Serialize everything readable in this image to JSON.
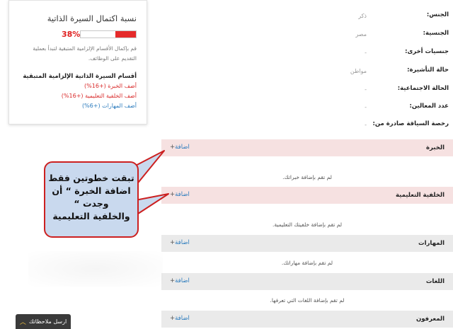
{
  "completion_card": {
    "title": "نسبة اكتمال السيرة الذاتية",
    "percent_text": "38%",
    "progress_value": 0.38,
    "note": "قم بإكمال الأقسام الإلزامية المتبقية لتبدأ بعملية التقديم على الوظائف.",
    "remaining_title": "أقسام السيرة الذاتية الإلزامية المتبقية",
    "links": [
      {
        "label": "أضف الخبرة (+16%)",
        "color": "red"
      },
      {
        "label": "أضف الخلفية التعليمية (+16%)",
        "color": "red"
      },
      {
        "label": "أضف المهارات (+6%)",
        "color": "blue"
      }
    ]
  },
  "profile_info": [
    {
      "label": "الجنس:",
      "value": "ذكر"
    },
    {
      "label": "الجنسية:",
      "value": "مصر"
    },
    {
      "label": "جنسيات أخرى:",
      "value": "-"
    },
    {
      "label": "حالة التأشيرة:",
      "value": "مواطن"
    },
    {
      "label": "الحالة الاجتماعية:",
      "value": "-"
    },
    {
      "label": "عدد المعالين:",
      "value": "-"
    },
    {
      "label": "رخصة السياقة صادرة من:",
      "value": "-"
    }
  ],
  "sections": [
    {
      "title": "الخبرة",
      "add_label": "اضافة",
      "empty_text": "لم تقم بإضافة خبراتك.",
      "style": "pink"
    },
    {
      "title": "الخلفية التعليمية",
      "add_label": "اضافة",
      "empty_text": "لم تقم بإضافة خلفيتك التعليمية.",
      "style": "pink"
    },
    {
      "title": "المهارات",
      "add_label": "اضافة",
      "empty_text": "لم تقم بإضافة مهاراتك.",
      "style": "gray"
    },
    {
      "title": "اللغات",
      "add_label": "اضافة",
      "empty_text": "لم تقم بإضافة اللغات التي تعرفها.",
      "style": "gray"
    },
    {
      "title": "المعرفون",
      "add_label": "اضافة",
      "empty_text": "",
      "style": "gray"
    }
  ],
  "plus_symbol": "+",
  "callout": {
    "lines": [
      "تبقت خطوتين فقط",
      "اضافة الخبرة “ أن",
      "وجدت “",
      "والخلفية التعليمية"
    ]
  },
  "feedback": {
    "label": "ارسل ملاحظاتك",
    "chevron": "︿"
  },
  "colors": {
    "accent_red": "#e52a2a",
    "link_blue": "#2b7bbd",
    "pink_header": "#f6e1e1",
    "gray_header": "#eaeaea",
    "callout_fill": "#c9d9ee"
  }
}
